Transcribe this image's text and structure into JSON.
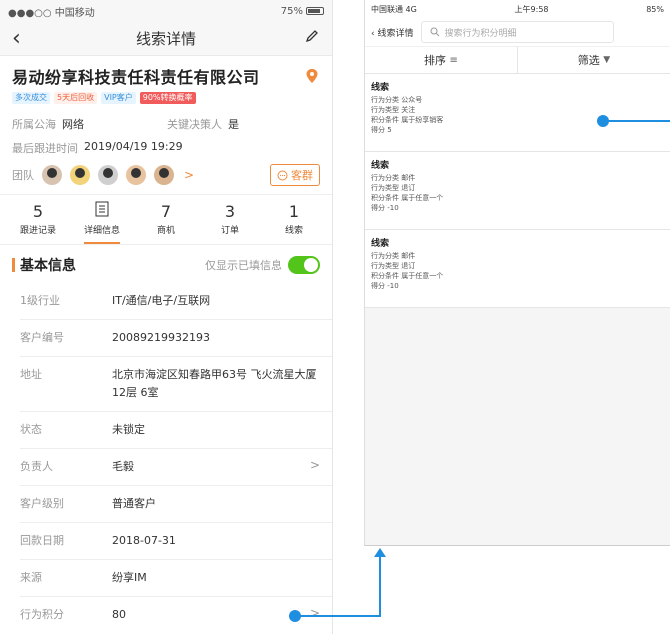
{
  "left": {
    "status": {
      "carrier": "●●●○○ 中国移动",
      "battery": "75%"
    },
    "nav": {
      "title": "线索详情"
    },
    "company": {
      "name": "易动纷享科技责任科责任有限公司"
    },
    "tags": [
      "多次成交",
      "5天后回收",
      "VIP客户",
      "90%转换概率"
    ],
    "pool": {
      "label": "所属公海",
      "value": "网络"
    },
    "decision": {
      "label": "关键决策人",
      "value": "是"
    },
    "last_follow": {
      "label": "最后跟进时间",
      "value": "2019/04/19 19:29"
    },
    "team": {
      "label": "团队",
      "group_label": "客群"
    },
    "stats": [
      {
        "num": "5",
        "label": "跟进记录"
      },
      {
        "num": "",
        "label": "详细信息"
      },
      {
        "num": "7",
        "label": "商机"
      },
      {
        "num": "3",
        "label": "订单"
      },
      {
        "num": "1",
        "label": "线索"
      }
    ],
    "section": {
      "title": "基本信息",
      "only_filled": "仅显示已填信息"
    },
    "fields": [
      {
        "k": "1级行业",
        "v": "IT/通信/电子/互联网"
      },
      {
        "k": "客户编号",
        "v": "20089219932193"
      },
      {
        "k": "地址",
        "v": "北京市海淀区知春路甲63号 飞火流星大厦 12层 6室"
      },
      {
        "k": "状态",
        "v": "未锁定"
      },
      {
        "k": "负责人",
        "v": "毛毅"
      },
      {
        "k": "客户级别",
        "v": "普通客户"
      },
      {
        "k": "回款日期",
        "v": "2018-07-31"
      },
      {
        "k": "来源",
        "v": "纷享IM"
      },
      {
        "k": "行为积分",
        "v": "80"
      }
    ]
  },
  "right": {
    "status": {
      "carrier": "中国联通 4G",
      "time": "上午9:58",
      "battery": "85%"
    },
    "nav": {
      "back": "线索详情",
      "placeholder": "搜索行为积分明细"
    },
    "filter": {
      "sort": "排序",
      "filter": "筛选"
    },
    "cards": [
      {
        "title": "线索",
        "lines": [
          "行为分类 公众号",
          "行为类型 关注",
          "积分条件 属于纷享销客",
          "得分 5"
        ]
      },
      {
        "title": "线索",
        "lines": [
          "行为分类 邮件",
          "行为类型 退订",
          "积分条件 属于任意一个",
          "得分 -10"
        ]
      },
      {
        "title": "线索",
        "lines": [
          "行为分类 邮件",
          "行为类型 退订",
          "积分条件 属于任意一个",
          "得分 -10"
        ]
      }
    ]
  },
  "colors": {
    "accent": "#f08a3c",
    "link": "#1e8fe0",
    "toggle": "#52c41a"
  }
}
